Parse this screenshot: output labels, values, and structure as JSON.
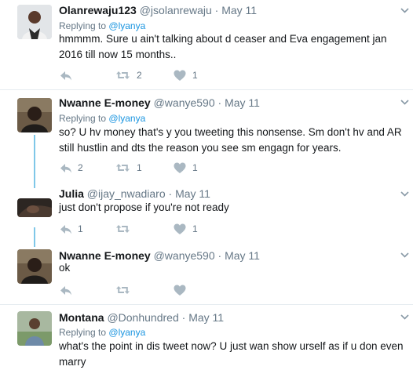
{
  "tweets": [
    {
      "name": "Olanrewaju123",
      "handle": "@jsolanrewaju",
      "dot": "·",
      "date": "May 11",
      "replying_prefix": "Replying to",
      "replying_to": "@lyanya",
      "text": "hmmmm. Sure u ain't talking about d ceaser and Eva engagement jan 2016 till now 15 months..",
      "retweets": "2",
      "likes": "1"
    },
    {
      "name": "Nwanne E-money",
      "handle": "@wanye590",
      "dot": "·",
      "date": "May 11",
      "replying_prefix": "Replying to",
      "replying_to": "@lyanya",
      "text": "so? U hv money that's y you tweeting this nonsense. Sm don't hv and AR still hustlin and dts the reason you see sm engagn for years.",
      "replies": "2",
      "retweets": "1",
      "likes": "1"
    },
    {
      "name": "Julia",
      "handle": "@ijay_nwadiaro",
      "dot": "·",
      "date": "May 11",
      "text": "just don't propose if you're not ready",
      "replies": "1",
      "likes": "1"
    },
    {
      "name": "Nwanne E-money",
      "handle": "@wanye590",
      "dot": "·",
      "date": "May 11",
      "text": "ok"
    },
    {
      "name": "Montana",
      "handle": "@Donhundred",
      "dot": "·",
      "date": "May 11",
      "replying_prefix": "Replying to",
      "replying_to": "@lyanya",
      "text": "what's the point in dis tweet now? U just wan show urself as if u don even marry"
    }
  ],
  "colors": {
    "link": "#1b95e0",
    "thread_line": "#7fc7e8",
    "secondary_text": "#657786",
    "icon": "#aab8c2"
  },
  "icons": [
    "reply-icon",
    "retweet-icon",
    "like-icon",
    "caret-down-icon"
  ]
}
